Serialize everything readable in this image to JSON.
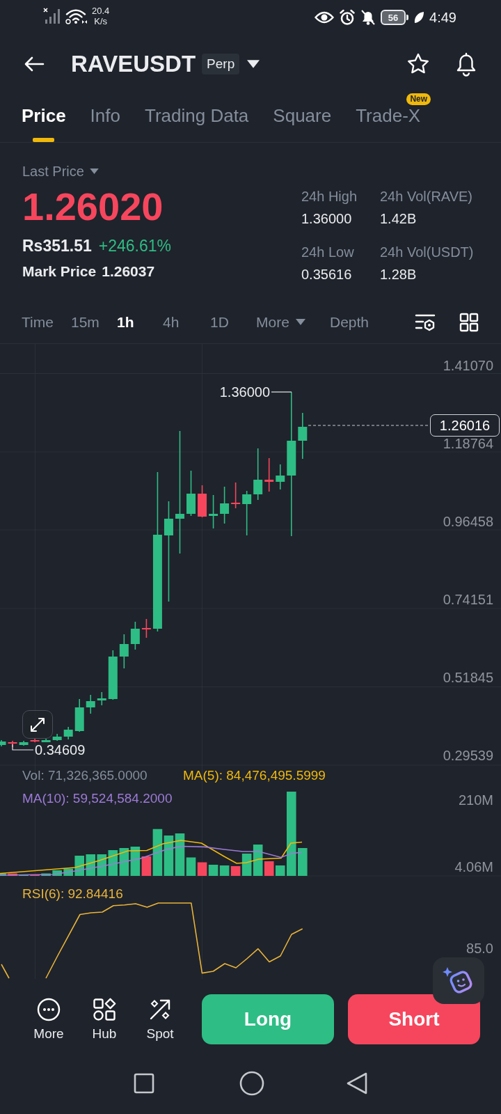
{
  "status_bar": {
    "network_speed": "20.4",
    "speed_unit": "K/s",
    "battery": "56",
    "time": "4:49"
  },
  "header": {
    "symbol": "RAVEUSDT",
    "contract_type": "Perp"
  },
  "tabs": [
    {
      "label": "Price",
      "selected": true
    },
    {
      "label": "Info",
      "selected": false
    },
    {
      "label": "Trading Data",
      "selected": false
    },
    {
      "label": "Square",
      "selected": false
    },
    {
      "label": "Trade-X",
      "selected": false,
      "badge": "New"
    }
  ],
  "price_summary": {
    "price_type": "Last Price",
    "last_price": "1.26020",
    "fiat_price": "Rs351.51",
    "change": "+246.61%",
    "mark_price_label": "Mark Price",
    "mark_price": "1.26037"
  },
  "stats": [
    {
      "label": "24h High",
      "value": "1.36000"
    },
    {
      "label": "24h Vol(RAVE)",
      "value": "1.42B"
    },
    {
      "label": "24h Low",
      "value": "0.35616"
    },
    {
      "label": "24h Vol(USDT)",
      "value": "1.28B"
    }
  ],
  "intervals": [
    {
      "label": "Time",
      "kind": "option",
      "selected": false
    },
    {
      "label": "15m",
      "kind": "option",
      "selected": false
    },
    {
      "label": "1h",
      "kind": "option",
      "selected": true
    },
    {
      "label": "4h",
      "kind": "option",
      "selected": false
    },
    {
      "label": "1D",
      "kind": "option",
      "selected": false
    },
    {
      "label": "More",
      "kind": "dropdown",
      "selected": false
    },
    {
      "label": "Depth",
      "kind": "option",
      "selected": false
    }
  ],
  "chart": {
    "price_axis": [
      "1.41070",
      "1.18764",
      "0.96458",
      "0.74151",
      "0.51845",
      "0.29539"
    ],
    "high_label": "1.36000",
    "low_label": "0.34609",
    "current_price": "1.26016"
  },
  "volume": {
    "vol": "Vol: 71,326,365.0000",
    "ma5": "MA(5): 84,476,495.5999",
    "ma10": "MA(10): 59,524,584.2000",
    "axis": [
      "210M",
      "4.06M"
    ]
  },
  "rsi": {
    "label": "RSI(6): 92.84416",
    "axis": [
      "85.0"
    ]
  },
  "bottom_bar": {
    "shortcuts": [
      "More",
      "Hub",
      "Spot"
    ],
    "long": "Long",
    "short": "Short"
  }
}
